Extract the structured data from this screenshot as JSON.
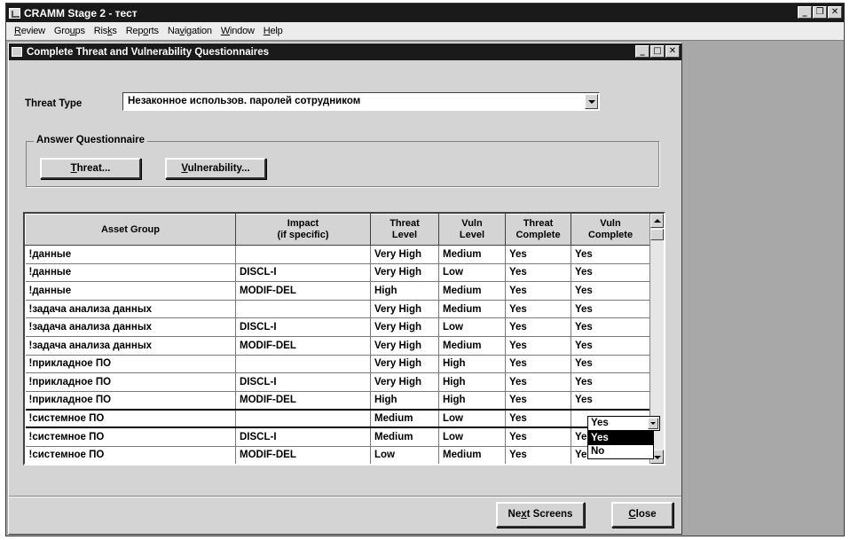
{
  "app": {
    "title": "CRAMM Stage 2 - тест",
    "menu": [
      {
        "pre": "",
        "u": "R",
        "post": "eview"
      },
      {
        "pre": "Gro",
        "u": "u",
        "post": "ps"
      },
      {
        "pre": "Ris",
        "u": "k",
        "post": "s"
      },
      {
        "pre": "Rep",
        "u": "o",
        "post": "rts"
      },
      {
        "pre": "Na",
        "u": "v",
        "post": "igation"
      },
      {
        "pre": "",
        "u": "W",
        "post": "indow"
      },
      {
        "pre": "",
        "u": "H",
        "post": "elp"
      }
    ]
  },
  "dialog": {
    "title": "Complete Threat and Vulnerability Questionnaires",
    "threat_type_label": "Threat Type",
    "threat_type_value": "Незаконное использов. паролей сотрудником",
    "answer_group_label": "Answer Questionnaire",
    "threat_button": {
      "u": "T",
      "rest": "hreat..."
    },
    "vuln_button": {
      "u": "V",
      "rest": "ulnerability..."
    },
    "next_button": {
      "pre": "Ne",
      "u": "x",
      "post": "t Screens"
    },
    "close_button": {
      "u": "C",
      "rest": "lose"
    }
  },
  "grid": {
    "headers": [
      "Asset Group",
      "Impact\n(if specific)",
      "Threat\nLevel",
      "Vuln\nLevel",
      "Threat\nComplete",
      "Vuln\nComplete"
    ],
    "rows": [
      [
        "!данные",
        "",
        "Very High",
        "Medium",
        "Yes",
        "Yes"
      ],
      [
        "!данные",
        "DISCL-I",
        "Very High",
        "Low",
        "Yes",
        "Yes"
      ],
      [
        "!данные",
        "MODIF-DEL",
        "High",
        "Medium",
        "Yes",
        "Yes"
      ],
      [
        "!задача анализа данных",
        "",
        "Very High",
        "Medium",
        "Yes",
        "Yes"
      ],
      [
        "!задача анализа данных",
        "DISCL-I",
        "Very High",
        "Low",
        "Yes",
        "Yes"
      ],
      [
        "!задача анализа данных",
        "MODIF-DEL",
        "Very High",
        "Medium",
        "Yes",
        "Yes"
      ],
      [
        "!прикладное ПО",
        "",
        "Very High",
        "High",
        "Yes",
        "Yes"
      ],
      [
        "!прикладное ПО",
        "DISCL-I",
        "Very High",
        "High",
        "Yes",
        "Yes"
      ],
      [
        "!прикладное ПО",
        "MODIF-DEL",
        "High",
        "High",
        "Yes",
        "Yes"
      ],
      [
        "!системное ПО",
        "",
        "Medium",
        "Low",
        "Yes",
        "Yes"
      ],
      [
        "!системное ПО",
        "DISCL-I",
        "Medium",
        "Low",
        "Yes",
        "Yes"
      ],
      [
        "!системное ПО",
        "MODIF-DEL",
        "Low",
        "Medium",
        "Yes",
        "Yes"
      ]
    ],
    "selected_row": 9,
    "dropdown": {
      "value": "Yes",
      "options": [
        "Yes",
        "No"
      ],
      "highlighted": "Yes"
    }
  }
}
